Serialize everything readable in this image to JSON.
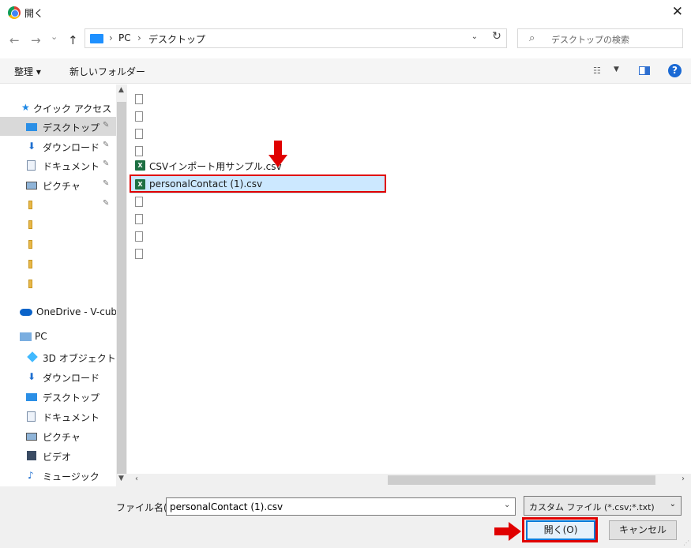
{
  "window": {
    "title": "開く"
  },
  "nav": {
    "back": "←",
    "forward": "→",
    "recent": "⌄",
    "up": "↑",
    "breadcrumb": [
      "PC",
      "デスクトップ"
    ],
    "separator": "›",
    "search_placeholder": "デスクトップの検索"
  },
  "toolbar": {
    "organize_label": "整理 ▾",
    "new_folder_label": "新しいフォルダー"
  },
  "sidebar": {
    "quick_access": "クイック アクセス",
    "items": [
      {
        "label": "デスクトップ",
        "icon": "desktop-icon",
        "pinned": true,
        "selected": true
      },
      {
        "label": "ダウンロード",
        "icon": "download-icon",
        "pinned": true
      },
      {
        "label": "ドキュメント",
        "icon": "document-icon",
        "pinned": true
      },
      {
        "label": "ピクチャ",
        "icon": "picture-icon",
        "pinned": true
      },
      {
        "label": "",
        "icon": "folder-icon",
        "pinned": true
      },
      {
        "label": "",
        "icon": "folder-icon"
      },
      {
        "label": "",
        "icon": "folder-icon"
      },
      {
        "label": "",
        "icon": "folder-icon"
      },
      {
        "label": "",
        "icon": "folder-icon"
      }
    ],
    "onedrive": "OneDrive - V-cube",
    "pc": "PC",
    "pc_items": [
      {
        "label": "3D オブジェクト",
        "icon": "3d-objects-icon"
      },
      {
        "label": "ダウンロード",
        "icon": "download-icon"
      },
      {
        "label": "デスクトップ",
        "icon": "desktop-icon"
      },
      {
        "label": "ドキュメント",
        "icon": "document-icon"
      },
      {
        "label": "ピクチャ",
        "icon": "picture-icon"
      },
      {
        "label": "ビデオ",
        "icon": "video-icon"
      },
      {
        "label": "ミュージック",
        "icon": "music-icon"
      }
    ]
  },
  "files": [
    {
      "name": "",
      "icon": "blank-file-icon"
    },
    {
      "name": "",
      "icon": "blank-file-icon"
    },
    {
      "name": "",
      "icon": "blank-file-icon"
    },
    {
      "name": "",
      "icon": "blank-file-icon"
    },
    {
      "name": "CSVインポート用サンプル.csv",
      "icon": "excel-csv-icon"
    },
    {
      "name": "personalContact (1).csv",
      "icon": "excel-csv-icon",
      "selected": true
    },
    {
      "name": "",
      "icon": "blank-file-icon"
    },
    {
      "name": "",
      "icon": "blank-file-icon"
    },
    {
      "name": "",
      "icon": "blank-file-icon"
    },
    {
      "name": "",
      "icon": "blank-file-icon"
    }
  ],
  "bottom": {
    "filename_label": "ファイル名(N):",
    "filename_value": "personalContact (1).csv",
    "filetype_value": "カスタム ファイル (*.csv;*.txt)",
    "open_label": "開く(O)",
    "cancel_label": "キャンセル"
  },
  "colors": {
    "highlight": "#e00000",
    "selection": "#cce8ff",
    "accent": "#0078d7"
  }
}
